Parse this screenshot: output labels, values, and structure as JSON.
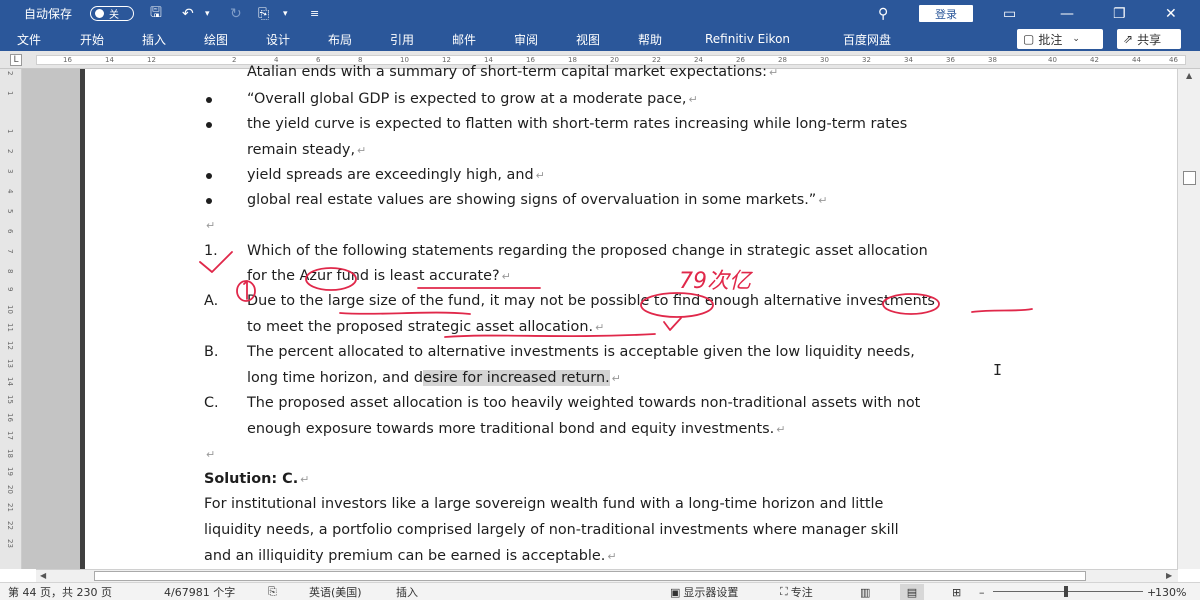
{
  "titlebar": {
    "autosave_label": "自动保存",
    "autosave_state": "关",
    "login": "登录"
  },
  "ribbon": {
    "tabs": [
      "文件",
      "开始",
      "插入",
      "绘图",
      "设计",
      "布局",
      "引用",
      "邮件",
      "审阅",
      "视图",
      "帮助",
      "Refinitiv Eikon",
      "百度网盘"
    ],
    "comment": "批注",
    "share": "共享"
  },
  "ruler": {
    "ticks": [
      "16",
      "14",
      "12",
      "2",
      "4",
      "6",
      "8",
      "10",
      "12",
      "14",
      "16",
      "18",
      "20",
      "22",
      "24",
      "26",
      "28",
      "30",
      "32",
      "34",
      "36",
      "38",
      "40",
      "42",
      "44",
      "46"
    ],
    "tab_marker": "L"
  },
  "vruler": {
    "ticks": [
      "2",
      "1",
      "1",
      "2",
      "3",
      "4",
      "5",
      "6",
      "7",
      "8",
      "9",
      "10",
      "11",
      "12",
      "13",
      "14",
      "15",
      "16",
      "17",
      "18",
      "19",
      "20",
      "21",
      "22",
      "23"
    ]
  },
  "document": {
    "top_line": "Atalian ends with a summary of short-term capital market expectations:",
    "bullets": [
      "“Overall global GDP is expected to grow at a moderate pace,",
      "the yield curve is expected to flatten with short-term rates increasing while long-term rates",
      "remain steady,",
      "yield spreads are exceedingly high, and",
      "global real estate values are showing signs of overvaluation in some markets.”"
    ],
    "question_num": "1.",
    "question_line1": "Which of the following statements regarding the proposed change in strategic asset allocation",
    "question_line2": "for the Azur fund is least accurate?",
    "option_a_label": "A.",
    "option_a_line1": "Due to the large size of the fund, it may not be possible to find enough alternative investments",
    "option_a_line2": "to meet the proposed strategic asset allocation.",
    "option_b_label": "B.",
    "option_b_line1": "The percent allocated to alternative investments is acceptable given the low liquidity needs,",
    "option_b_line2_pre": "long time horizon, and d",
    "option_b_line2_hl": "esire for increased return.",
    "option_c_label": "C.",
    "option_c_line1": "The proposed asset allocation is too heavily weighted towards non-traditional assets with not",
    "option_c_line2": "enough exposure towards more traditional bond and equity investments.",
    "solution_heading": "Solution: C.",
    "solution_line1": "For institutional investors like a large sovereign wealth fund with a long-time horizon and little",
    "solution_line2": "liquidity needs, a portfolio comprised largely of non-traditional investments where manager skill",
    "solution_line3": "and an illiquidity premium can be earned is acceptable.",
    "para_mark": "↵",
    "handwritten_note": "79次亿"
  },
  "statusbar": {
    "page": "第 44 页，共 230 页",
    "words": "4/67981 个字",
    "language": "英语(美国)",
    "mode": "插入",
    "display_settings": "显示器设置",
    "focus": "专注",
    "zoom": "130%"
  },
  "colors": {
    "accent": "#2b579a",
    "ink": "#e0284a",
    "highlight": "#d4d4d4"
  }
}
